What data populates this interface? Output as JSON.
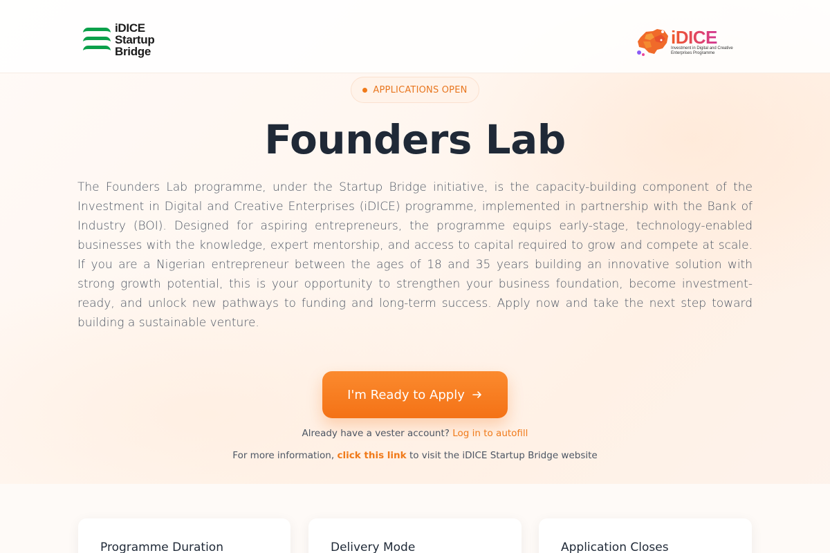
{
  "header": {
    "left_logo_lines": [
      "iDICE",
      "Startup",
      "Bridge"
    ],
    "right_logo_title": "iDICE",
    "right_logo_subtitle": "Investment in Digital and Creative Enterprises Programme"
  },
  "badge": {
    "label": "APPLICATIONS OPEN",
    "color": "#f07a1a"
  },
  "hero": {
    "title": "Founders Lab",
    "description": "The Founders Lab programme, under the Startup Bridge initiative, is the capacity-building component of the Investment in Digital and Creative Enterprises (iDICE) programme, implemented in partnership with the Bank of Industry (BOI). Designed for aspiring entrepreneurs, the programme equips early-stage, technology-enabled businesses with the knowledge, expert mentorship, and access to capital required to grow and compete at scale. If you are a Nigerian entrepreneur between the ages of 18 and 35 years building an innovative solution with strong growth potential, this is your opportunity to strengthen your business foundation, become investment-ready, and unlock new pathways to funding and long-term success. Apply now and take the next step toward building a sustainable venture."
  },
  "cta": {
    "label": "I'm Ready to Apply",
    "icon": "arrow-right-icon",
    "color": "#f47216"
  },
  "login": {
    "prefix": "Already have a vester account? ",
    "link": "Log in to autofill"
  },
  "info": {
    "prefix": "For more information, ",
    "link": "click this link",
    "suffix": " to visit the iDICE Startup Bridge website"
  },
  "cards": [
    {
      "title": "Programme Duration"
    },
    {
      "title": "Delivery Mode"
    },
    {
      "title": "Application Closes"
    }
  ],
  "colors": {
    "accent": "#f47216",
    "brand_green": "#0aa04a"
  }
}
